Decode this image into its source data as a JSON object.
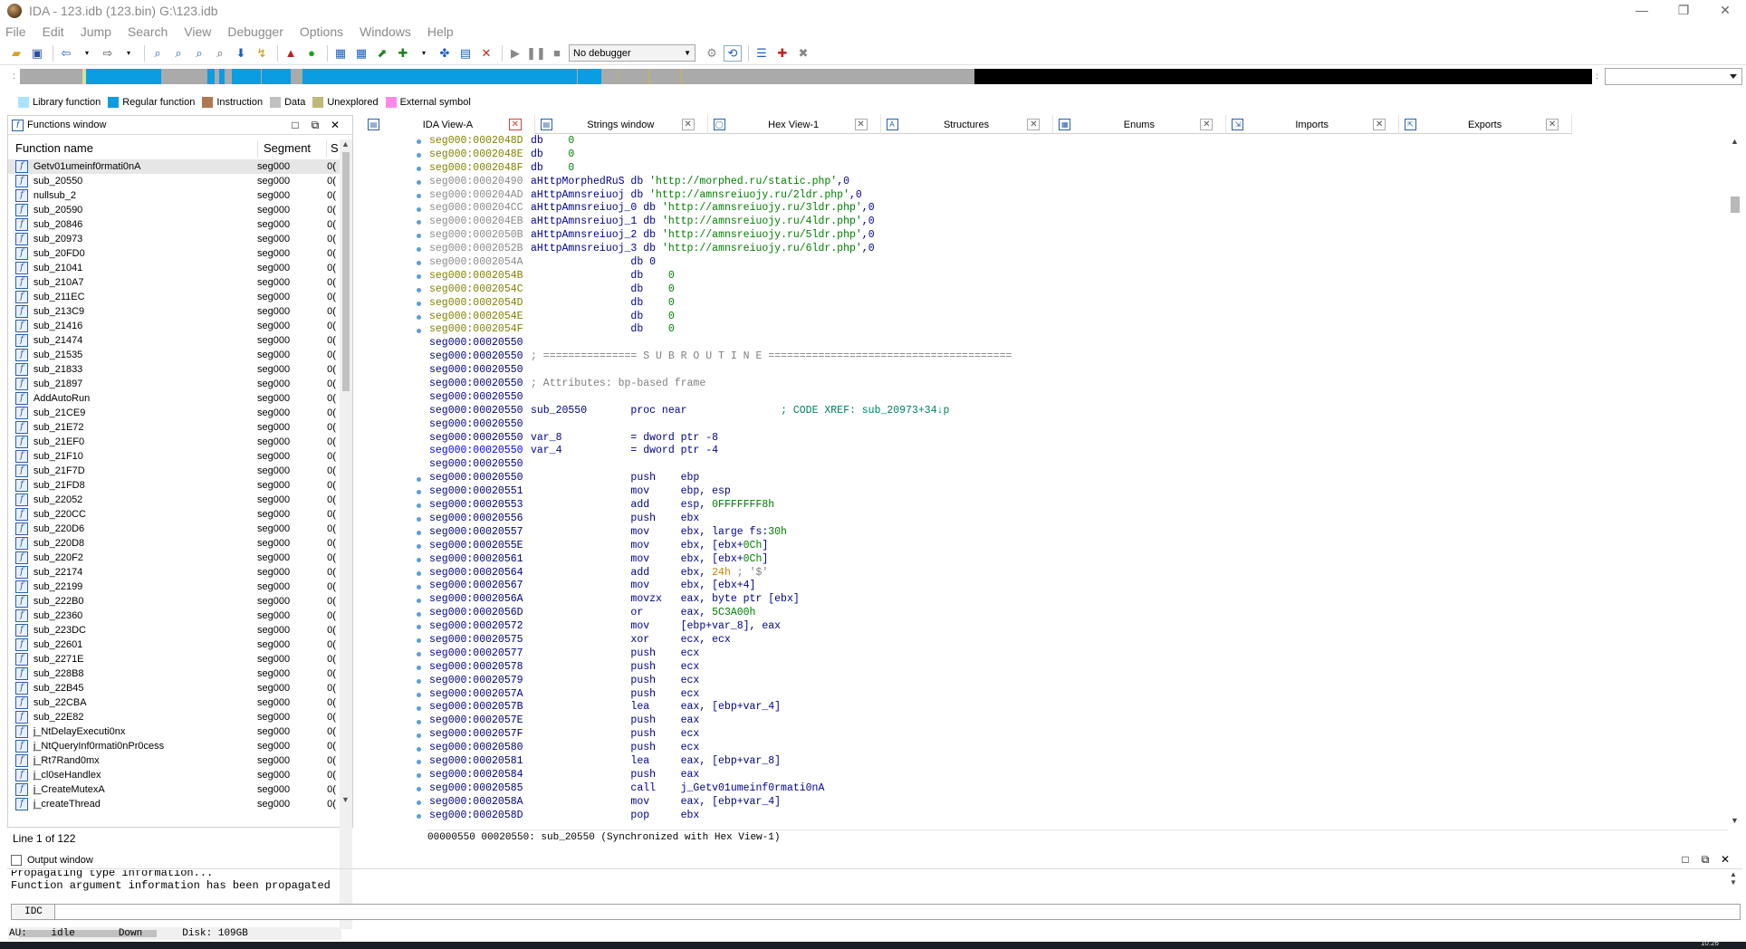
{
  "window": {
    "title": "IDA - 123.idb (123.bin) G:\\123.idb",
    "controls": [
      "—",
      "❐",
      "✕"
    ]
  },
  "menu": [
    {
      "label": "File"
    },
    {
      "label": "Edit"
    },
    {
      "label": "Jump"
    },
    {
      "label": "Search"
    },
    {
      "label": "View"
    },
    {
      "label": "Debugger"
    },
    {
      "label": "Options"
    },
    {
      "label": "Windows"
    },
    {
      "label": "Help"
    }
  ],
  "toolbar": {
    "debugger_select": "No debugger"
  },
  "navband": {
    "segments": [
      {
        "start": 0.0,
        "end": 0.032,
        "color": "#aaaaaa"
      },
      {
        "start": 0.032,
        "end": 0.04,
        "color": "#aaaaaa"
      },
      {
        "start": 0.04,
        "end": 0.042,
        "color": "#c8e6a0"
      },
      {
        "start": 0.042,
        "end": 0.09,
        "color": "#0a9de2"
      },
      {
        "start": 0.119,
        "end": 0.124,
        "color": "#0a9de2"
      },
      {
        "start": 0.127,
        "end": 0.13,
        "color": "#0a9de2"
      },
      {
        "start": 0.135,
        "end": 0.153,
        "color": "#0a9de2"
      },
      {
        "start": 0.154,
        "end": 0.172,
        "color": "#0a9de2"
      },
      {
        "start": 0.18,
        "end": 0.354,
        "color": "#0a9de2"
      },
      {
        "start": 0.355,
        "end": 0.37,
        "color": "#0a9de2"
      },
      {
        "start": 0.38,
        "end": 0.381,
        "color": "#c0b070"
      },
      {
        "start": 0.4,
        "end": 0.401,
        "color": "#c0b070"
      },
      {
        "start": 0.42,
        "end": 0.421,
        "color": "#c0b070"
      },
      {
        "start": 0.6,
        "end": 0.9,
        "color": "#aaaaaa"
      },
      {
        "start": 0.607,
        "end": 1.0,
        "color": "#000000"
      }
    ]
  },
  "legend": [
    {
      "label": "Library function",
      "color": "#a8e4ff"
    },
    {
      "label": "Regular function",
      "color": "#0a9de2"
    },
    {
      "label": "Instruction",
      "color": "#b07850"
    },
    {
      "label": "Data",
      "color": "#c0c0c0"
    },
    {
      "label": "Unexplored",
      "color": "#c0b878"
    },
    {
      "label": "External symbol",
      "color": "#ff88e8"
    }
  ],
  "functions_window": {
    "title": "Functions window",
    "columns": {
      "name": "Function name",
      "segment": "Segment",
      "start": "S"
    },
    "rows": [
      "Getv01umeinf0rmati0nA",
      "sub_20550",
      "nullsub_2",
      "sub_20590",
      "sub_20846",
      "sub_20973",
      "sub_20FD0",
      "sub_21041",
      "sub_210A7",
      "sub_211EC",
      "sub_213C9",
      "sub_21416",
      "sub_21474",
      "sub_21535",
      "sub_21833",
      "sub_21897",
      "AddAutoRun",
      "sub_21CE9",
      "sub_21E72",
      "sub_21EF0",
      "sub_21F10",
      "sub_21F7D",
      "sub_21FD8",
      "sub_22052",
      "sub_220CC",
      "sub_220D6",
      "sub_220D8",
      "sub_220F2",
      "sub_22174",
      "sub_22199",
      "sub_222B0",
      "sub_22360",
      "sub_223DC",
      "sub_22601",
      "sub_2271E",
      "sub_228B8",
      "sub_22B45",
      "sub_22CBA",
      "sub_22E82",
      "j_NtDelayExecuti0nx",
      "j_NtQueryInf0rmati0nPr0cess",
      "j_Rt7Rand0mx",
      "j_cl0seHandlex",
      "j_CreateMutexA",
      "j_createThread"
    ],
    "segment_value": "seg000",
    "start_value": "0(",
    "status": "Line 1 of 122"
  },
  "tabs": [
    {
      "label": "IDA View-A",
      "icon": "ida-view-icon",
      "active": true
    },
    {
      "label": "Strings window",
      "icon": "strings-icon",
      "active": false
    },
    {
      "label": "Hex View-1",
      "icon": "hex-view-icon",
      "active": false
    },
    {
      "label": "Structures",
      "icon": "structures-icon",
      "active": false
    },
    {
      "label": "Enums",
      "icon": "enums-icon",
      "active": false
    },
    {
      "label": "Imports",
      "icon": "imports-icon",
      "active": false
    },
    {
      "label": "Exports",
      "icon": "exports-icon",
      "active": false
    }
  ],
  "disasm": {
    "lines": [
      {
        "addr": "seg000:0002048D",
        "ac": "data",
        "p": [
          [
            "mn",
            "db    "
          ],
          [
            "num",
            "0"
          ]
        ]
      },
      {
        "addr": "seg000:0002048E",
        "ac": "data",
        "p": [
          [
            "mn",
            "db    "
          ],
          [
            "num",
            "0"
          ]
        ]
      },
      {
        "addr": "seg000:0002048F",
        "ac": "data",
        "p": [
          [
            "mn",
            "db    "
          ],
          [
            "num",
            "0"
          ]
        ]
      },
      {
        "addr": "seg000:00020490",
        "ac": "gray",
        "p": [
          [
            "nm",
            "aHttpMorphedRuS "
          ],
          [
            "mn",
            "db "
          ],
          [
            "str",
            "'http://morphed.ru/static.php'"
          ],
          [
            "mn",
            ",0"
          ]
        ]
      },
      {
        "addr": "seg000:000204AD",
        "ac": "gray",
        "p": [
          [
            "nm",
            "aHttpAmnsreiuoj "
          ],
          [
            "mn",
            "db "
          ],
          [
            "str",
            "'http://amnsreiuojy.ru/2ldr.php'"
          ],
          [
            "mn",
            ",0"
          ]
        ]
      },
      {
        "addr": "seg000:000204CC",
        "ac": "gray",
        "p": [
          [
            "nm",
            "aHttpAmnsreiuoj_0 "
          ],
          [
            "mn",
            "db "
          ],
          [
            "str",
            "'http://amnsreiuojy.ru/3ldr.php'"
          ],
          [
            "mn",
            ",0"
          ]
        ]
      },
      {
        "addr": "seg000:000204EB",
        "ac": "gray",
        "p": [
          [
            "nm",
            "aHttpAmnsreiuoj_1 "
          ],
          [
            "mn",
            "db "
          ],
          [
            "str",
            "'http://amnsreiuojy.ru/4ldr.php'"
          ],
          [
            "mn",
            ",0"
          ]
        ]
      },
      {
        "addr": "seg000:0002050B",
        "ac": "gray",
        "p": [
          [
            "nm",
            "aHttpAmnsreiuoj_2 "
          ],
          [
            "mn",
            "db "
          ],
          [
            "str",
            "'http://amnsreiuojy.ru/5ldr.php'"
          ],
          [
            "mn",
            ",0"
          ]
        ]
      },
      {
        "addr": "seg000:0002052B",
        "ac": "gray",
        "p": [
          [
            "nm",
            "aHttpAmnsreiuoj_3 "
          ],
          [
            "mn",
            "db "
          ],
          [
            "str",
            "'http://amnsreiuojy.ru/6ldr.php'"
          ],
          [
            "mn",
            ",0"
          ]
        ]
      },
      {
        "addr": "seg000:0002054A",
        "ac": "gray",
        "p": [
          [
            "mn",
            "                db 0"
          ]
        ]
      },
      {
        "addr": "seg000:0002054B",
        "ac": "data",
        "p": [
          [
            "mn",
            "                db    "
          ],
          [
            "num",
            "0"
          ]
        ]
      },
      {
        "addr": "seg000:0002054C",
        "ac": "data",
        "p": [
          [
            "mn",
            "                db    "
          ],
          [
            "num",
            "0"
          ]
        ]
      },
      {
        "addr": "seg000:0002054D",
        "ac": "data",
        "p": [
          [
            "mn",
            "                db    "
          ],
          [
            "num",
            "0"
          ]
        ]
      },
      {
        "addr": "seg000:0002054E",
        "ac": "data",
        "p": [
          [
            "mn",
            "                db    "
          ],
          [
            "num",
            "0"
          ]
        ]
      },
      {
        "addr": "seg000:0002054F",
        "ac": "data",
        "p": [
          [
            "mn",
            "                db    "
          ],
          [
            "num",
            "0"
          ]
        ]
      },
      {
        "addr": "seg000:00020550",
        "ac": "code",
        "p": []
      },
      {
        "addr": "seg000:00020550",
        "ac": "code",
        "p": [
          [
            "cmt",
            "; =============== S U B R O U T I N E ======================================="
          ]
        ]
      },
      {
        "addr": "seg000:00020550",
        "ac": "code",
        "p": []
      },
      {
        "addr": "seg000:00020550",
        "ac": "code",
        "p": [
          [
            "cmt",
            "; Attributes: bp-based frame"
          ]
        ]
      },
      {
        "addr": "seg000:00020550",
        "ac": "code",
        "p": []
      },
      {
        "addr": "seg000:00020550",
        "ac": "code",
        "p": [
          [
            "nm",
            "sub_20550       "
          ],
          [
            "mn",
            "proc near               "
          ],
          [
            "xref",
            "; CODE XREF: sub_20973+34↓p"
          ]
        ]
      },
      {
        "addr": "seg000:00020550",
        "ac": "code",
        "p": []
      },
      {
        "addr": "seg000:00020550",
        "ac": "code",
        "p": [
          [
            "nm",
            "var_8           "
          ],
          [
            "mn",
            "= dword ptr -8"
          ]
        ]
      },
      {
        "addr": "seg000:00020550",
        "ac": "sel",
        "p": [
          [
            "nm",
            "var_4           "
          ],
          [
            "mn",
            "= dword ptr -4"
          ]
        ]
      },
      {
        "addr": "seg000:00020550",
        "ac": "code",
        "p": []
      },
      {
        "addr": "seg000:00020550",
        "ac": "code",
        "p": [
          [
            "mn",
            "                push    ebp"
          ]
        ]
      },
      {
        "addr": "seg000:00020551",
        "ac": "code",
        "p": [
          [
            "mn",
            "                mov     ebp, esp"
          ]
        ]
      },
      {
        "addr": "seg000:00020553",
        "ac": "code",
        "p": [
          [
            "mn",
            "                add     esp, "
          ],
          [
            "num",
            "0FFFFFFF8h"
          ]
        ]
      },
      {
        "addr": "seg000:00020556",
        "ac": "code",
        "p": [
          [
            "mn",
            "                push    ebx"
          ]
        ]
      },
      {
        "addr": "seg000:00020557",
        "ac": "code",
        "p": [
          [
            "mn",
            "                mov     ebx, large fs:"
          ],
          [
            "num",
            "30h"
          ]
        ]
      },
      {
        "addr": "seg000:0002055E",
        "ac": "code",
        "p": [
          [
            "mn",
            "                mov     ebx, [ebx+"
          ],
          [
            "num",
            "0Ch"
          ],
          [
            "mn",
            "]"
          ]
        ]
      },
      {
        "addr": "seg000:00020561",
        "ac": "code",
        "p": [
          [
            "mn",
            "                mov     ebx, [ebx+"
          ],
          [
            "num",
            "0Ch"
          ],
          [
            "mn",
            "]"
          ]
        ]
      },
      {
        "addr": "seg000:00020564",
        "ac": "code",
        "p": [
          [
            "mn",
            "                add     ebx, "
          ],
          [
            "imm",
            "24h"
          ],
          [
            "cmt",
            " ; '$'"
          ]
        ]
      },
      {
        "addr": "seg000:00020567",
        "ac": "code",
        "p": [
          [
            "mn",
            "                mov     ebx, [ebx+4]"
          ]
        ]
      },
      {
        "addr": "seg000:0002056A",
        "ac": "code",
        "p": [
          [
            "mn",
            "                movzx   eax, byte ptr [ebx]"
          ]
        ]
      },
      {
        "addr": "seg000:0002056D",
        "ac": "code",
        "p": [
          [
            "mn",
            "                or      eax, "
          ],
          [
            "num",
            "5C3A00h"
          ]
        ]
      },
      {
        "addr": "seg000:00020572",
        "ac": "code",
        "p": [
          [
            "mn",
            "                mov     [ebp+var_8], eax"
          ]
        ]
      },
      {
        "addr": "seg000:00020575",
        "ac": "code",
        "p": [
          [
            "mn",
            "                xor     ecx, ecx"
          ]
        ]
      },
      {
        "addr": "seg000:00020577",
        "ac": "code",
        "p": [
          [
            "mn",
            "                push    ecx"
          ]
        ]
      },
      {
        "addr": "seg000:00020578",
        "ac": "code",
        "p": [
          [
            "mn",
            "                push    ecx"
          ]
        ]
      },
      {
        "addr": "seg000:00020579",
        "ac": "code",
        "p": [
          [
            "mn",
            "                push    ecx"
          ]
        ]
      },
      {
        "addr": "seg000:0002057A",
        "ac": "code",
        "p": [
          [
            "mn",
            "                push    ecx"
          ]
        ]
      },
      {
        "addr": "seg000:0002057B",
        "ac": "code",
        "p": [
          [
            "mn",
            "                lea     eax, [ebp+var_4]"
          ]
        ]
      },
      {
        "addr": "seg000:0002057E",
        "ac": "code",
        "p": [
          [
            "mn",
            "                push    eax"
          ]
        ]
      },
      {
        "addr": "seg000:0002057F",
        "ac": "code",
        "p": [
          [
            "mn",
            "                push    ecx"
          ]
        ]
      },
      {
        "addr": "seg000:00020580",
        "ac": "code",
        "p": [
          [
            "mn",
            "                push    ecx"
          ]
        ]
      },
      {
        "addr": "seg000:00020581",
        "ac": "code",
        "p": [
          [
            "mn",
            "                lea     eax, [ebp+var_8]"
          ]
        ]
      },
      {
        "addr": "seg000:00020584",
        "ac": "code",
        "p": [
          [
            "mn",
            "                push    eax"
          ]
        ]
      },
      {
        "addr": "seg000:00020585",
        "ac": "code",
        "p": [
          [
            "mn",
            "                call    j_Getv01umeinf0rmati0nA"
          ]
        ]
      },
      {
        "addr": "seg000:0002058A",
        "ac": "code",
        "p": [
          [
            "mn",
            "                mov     eax, [ebp+var_4]"
          ]
        ]
      },
      {
        "addr": "seg000:0002058D",
        "ac": "code",
        "p": [
          [
            "mn",
            "                pop     ebx"
          ]
        ]
      }
    ],
    "dots": [
      0,
      1,
      2,
      3,
      4,
      5,
      6,
      7,
      8,
      9,
      10,
      11,
      12,
      13,
      14,
      25,
      26,
      27,
      28,
      29,
      30,
      31,
      32,
      33,
      34,
      35,
      36,
      37,
      38,
      39,
      40,
      41,
      42,
      43,
      44,
      45,
      46,
      47,
      48,
      49,
      50
    ],
    "status": "00000550 00020550: sub_20550 (Synchronized with Hex View-1)"
  },
  "output": {
    "title": "Output window",
    "lines": [
      "Propagating type information...",
      "Function argument information has been propagated"
    ]
  },
  "idc": {
    "label": "IDC"
  },
  "status": {
    "au": "AU:",
    "state": "idle",
    "dir": "Down",
    "disk": "Disk: 109GB"
  },
  "taskbar": {
    "clock": "10:26"
  }
}
